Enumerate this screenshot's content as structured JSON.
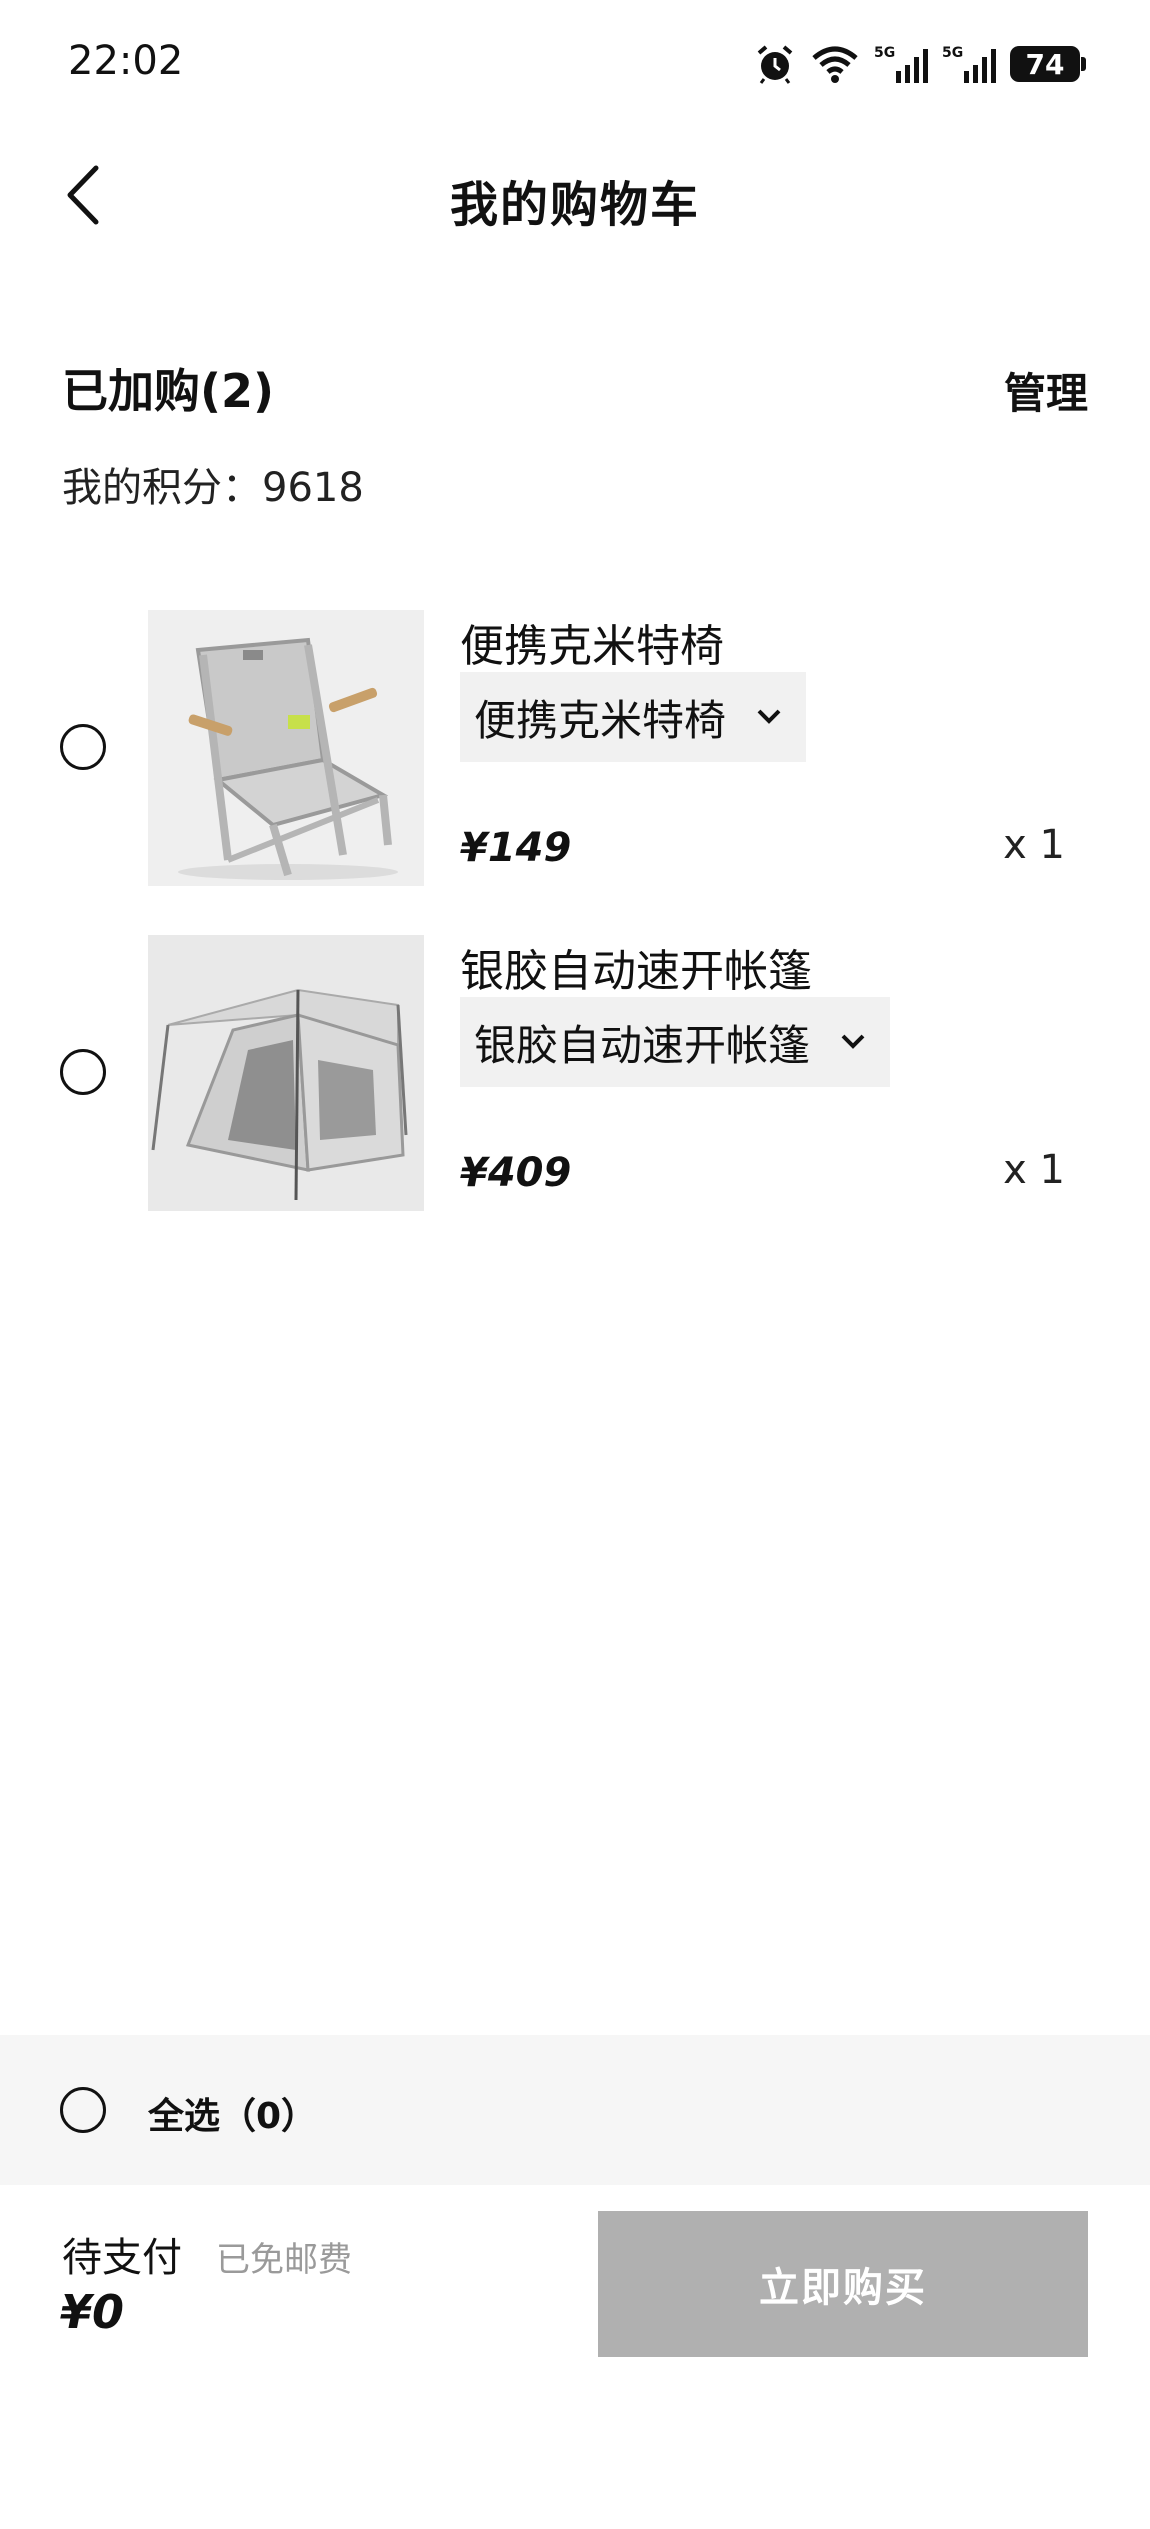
{
  "status_bar": {
    "time": "22:02",
    "battery": "74",
    "network": "5G"
  },
  "header": {
    "title": "我的购物车"
  },
  "cart": {
    "count_label": "已加购(2)",
    "manage_label": "管理",
    "points_label": "我的积分：9618"
  },
  "items": [
    {
      "name": "便携克米特椅",
      "variant": "便携克米特椅",
      "price": "¥149",
      "quantity": "x 1",
      "image": "folding-chair-image"
    },
    {
      "name": "银胶自动速开帐篷",
      "variant": "银胶自动速开帐篷",
      "price": "¥409",
      "quantity": "x 1",
      "image": "tent-image"
    }
  ],
  "footer": {
    "select_all_label": "全选（0）",
    "pay_label": "待支付",
    "shipping_label": "已免邮费",
    "total": "¥0",
    "buy_label": "立即购买"
  },
  "colors": {
    "buy_button_disabled": "#b0b0b0",
    "select_bar_bg": "#f6f6f6",
    "variant_bg": "#f1f1f1"
  }
}
